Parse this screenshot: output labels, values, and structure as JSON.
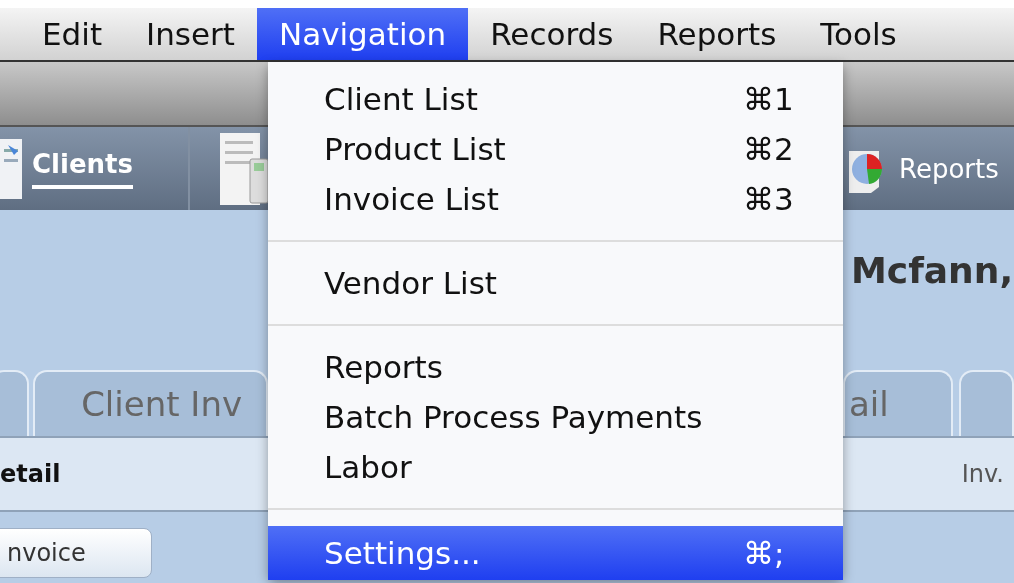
{
  "menu_bar": [
    {
      "label": "Edit",
      "selected": false
    },
    {
      "label": "Insert",
      "selected": false
    },
    {
      "label": "Navigation",
      "selected": true
    },
    {
      "label": "Records",
      "selected": false
    },
    {
      "label": "Reports",
      "selected": false
    },
    {
      "label": "Tools",
      "selected": false
    }
  ],
  "navigation_menu": [
    {
      "kind": "item",
      "label": "Client List",
      "shortcut": "⌘1",
      "selected": false
    },
    {
      "kind": "item",
      "label": "Product List",
      "shortcut": "⌘2",
      "selected": false
    },
    {
      "kind": "item",
      "label": "Invoice List",
      "shortcut": "⌘3",
      "selected": false
    },
    {
      "kind": "separator"
    },
    {
      "kind": "item",
      "label": "Vendor List",
      "selected": false
    },
    {
      "kind": "separator"
    },
    {
      "kind": "item",
      "label": "Reports",
      "selected": false
    },
    {
      "kind": "item",
      "label": "Batch Process Payments",
      "selected": false
    },
    {
      "kind": "item",
      "label": "Labor",
      "selected": false
    },
    {
      "kind": "separator"
    },
    {
      "kind": "item",
      "label": "Settings...",
      "shortcut": "⌘;",
      "selected": true
    }
  ],
  "toolbar": [
    {
      "label": "Clients",
      "selected": true
    },
    {
      "label": "Reports",
      "selected": false
    }
  ],
  "record_title": "Mcfann,",
  "tabs": [
    {
      "label": "Client Inv"
    },
    {
      "label": "ail"
    }
  ],
  "detail_header": {
    "title": "etail",
    "column": "Inv."
  },
  "button": "nvoice"
}
